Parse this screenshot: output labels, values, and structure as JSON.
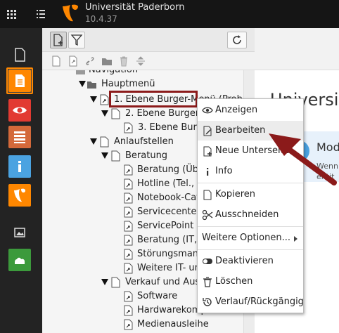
{
  "app": {
    "site_name": "Universität Paderborn",
    "version": "10.4.37",
    "brand_color": "#ff8700"
  },
  "modules": [
    {
      "name": "page-module-icon",
      "color": "#ff8700"
    },
    {
      "name": "view-module-icon",
      "color": "#e23a32"
    },
    {
      "name": "list-module-icon",
      "color": "#d4693a"
    },
    {
      "name": "info-module-icon",
      "color": "#4ba3e1"
    },
    {
      "name": "template-module-icon",
      "color": "#ff8700"
    },
    {
      "name": "filelist-module-icon",
      "color": "#5a5a5a"
    },
    {
      "name": "sites-module-icon",
      "color": "#3c9a3c"
    }
  ],
  "tree": {
    "nodes": [
      {
        "label": "Navigation"
      },
      {
        "label": "Hauptmenü"
      },
      {
        "label": "1. Ebene Burger-Menü (Probe"
      },
      {
        "label": "2. Ebene Burger-"
      },
      {
        "label": "3. Ebene Burge"
      },
      {
        "label": "Anlaufstellen"
      },
      {
        "label": "Beratung"
      },
      {
        "label": "Beratung (Üb"
      },
      {
        "label": "Hotline (Tel., E"
      },
      {
        "label": "Notebook-Caf"
      },
      {
        "label": "Servicecenter"
      },
      {
        "label": "ServicePoint"
      },
      {
        "label": "Beratung (IT,"
      },
      {
        "label": "Störungsman"
      },
      {
        "label": "Weitere IT- un"
      },
      {
        "label": "Verkauf und Aus"
      },
      {
        "label": "Software"
      },
      {
        "label": "Hardwarekomponenten"
      },
      {
        "label": "Medienausleihe"
      }
    ]
  },
  "content": {
    "title": "Universi",
    "info_title": "Mod",
    "info_text_1": "Wenn",
    "info_text_2": "entit"
  },
  "context_menu": {
    "items": [
      {
        "label": "Anzeigen",
        "icon": "eye-icon"
      },
      {
        "label": "Bearbeiten",
        "icon": "edit-icon"
      },
      {
        "label": "Neue Unterseite",
        "icon": "new-page-icon"
      },
      {
        "label": "Info",
        "icon": "info-icon"
      },
      {
        "label": "Kopieren",
        "icon": "copy-icon"
      },
      {
        "label": "Ausschneiden",
        "icon": "cut-icon"
      },
      {
        "label": "Weitere Optionen...",
        "icon": ""
      },
      {
        "label": "Deaktivieren",
        "icon": "toggle-icon"
      },
      {
        "label": "Löschen",
        "icon": "trash-icon"
      },
      {
        "label": "Verlauf/Rückgängig",
        "icon": "history-icon"
      }
    ]
  },
  "colors": {
    "annotation": "#8b1a1a"
  }
}
